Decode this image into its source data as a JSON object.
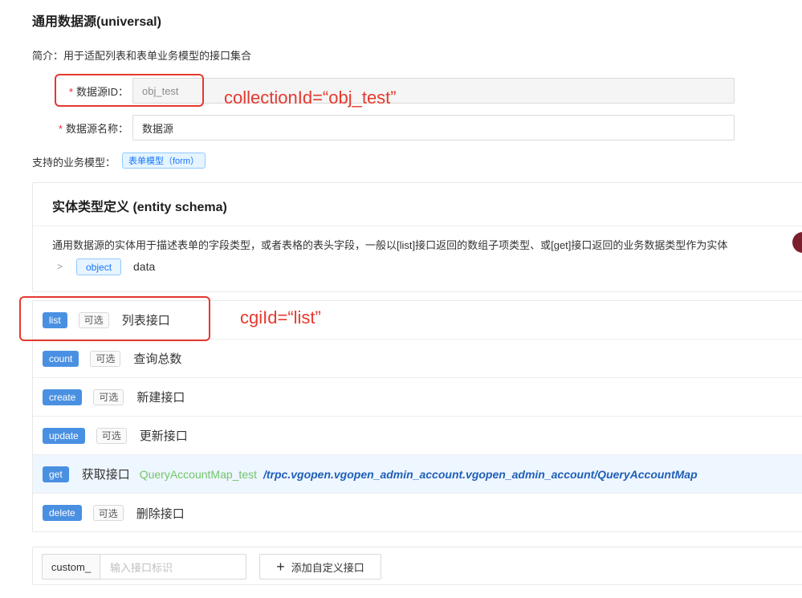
{
  "header": {
    "title": "通用数据源(universal)",
    "intro": "简介：用于适配列表和表单业务模型的接口集合"
  },
  "form": {
    "id_label": "数据源ID：",
    "id_value": "obj_test",
    "name_label": "数据源名称：",
    "name_value": "数据源",
    "required_mark": "*"
  },
  "support": {
    "label": "支持的业务模型：",
    "tag": "表单模型（form）"
  },
  "schema": {
    "title": "实体类型定义 (entity schema)",
    "description": "通用数据源的实体用于描述表单的字段类型，或者表格的表头字段，一般以[list]接口返回的数组子项类型、或[get]接口返回的业务数据类型作为实体",
    "expand_arrow": ">",
    "type_tag": "object",
    "field_name": "data"
  },
  "apis": [
    {
      "method": "list",
      "optional": "可选",
      "name": "列表接口"
    },
    {
      "method": "count",
      "optional": "可选",
      "name": "查询总数"
    },
    {
      "method": "create",
      "optional": "可选",
      "name": "新建接口"
    },
    {
      "method": "update",
      "optional": "可选",
      "name": "更新接口"
    },
    {
      "method": "get",
      "name": "获取接口",
      "model": "QueryAccountMap_test",
      "path": "/trpc.vgopen.vgopen_admin_account.vgopen_admin_account/QueryAccountMap"
    },
    {
      "method": "delete",
      "optional": "可选",
      "name": "删除接口"
    }
  ],
  "custom": {
    "prefix": "custom_",
    "placeholder": "输入接口标识",
    "add_label": "添加自定义接口",
    "add_icon": "+"
  },
  "annotations": {
    "collection_id": "collectionId=“obj_test”",
    "cgi_id": "cgiId=“list”"
  },
  "colors": {
    "annotation": "#e5392f",
    "method_tag": "#4a90e2",
    "get_row_bg": "#eef6ff",
    "model_name": "#73c56a",
    "path": "#1f5fb8"
  }
}
